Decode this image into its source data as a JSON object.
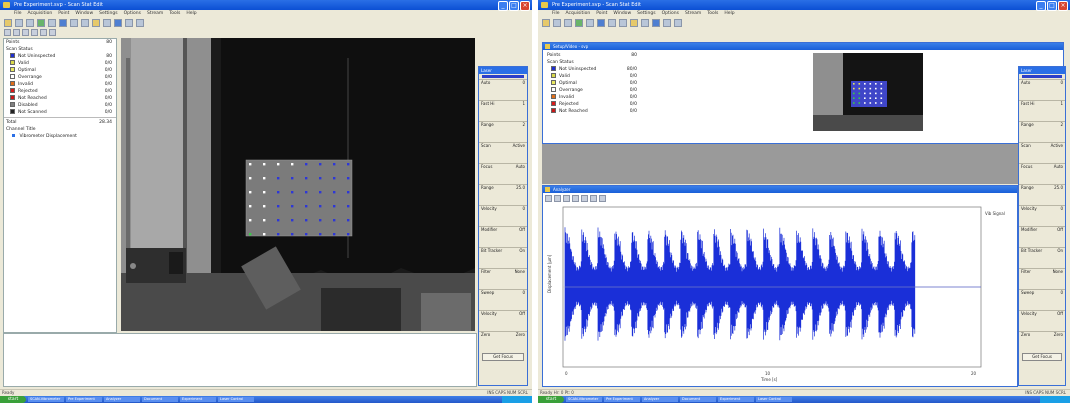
{
  "left": {
    "window_title": "Pre Experiment.svp - Scan Stat Edit",
    "menu": [
      "File",
      "Acquisition",
      "Point",
      "Window",
      "Settings",
      "Options",
      "Stream",
      "Tools",
      "Help"
    ],
    "tree_header": {
      "label": "Points",
      "value": "80"
    },
    "tree_group": "Scan Status",
    "points": [
      {
        "label": "Not Uninspected",
        "value": "80",
        "color": "#1f2fd0"
      },
      {
        "label": "Valid",
        "value": "0/0",
        "color": "#d8d84a"
      },
      {
        "label": "Optimal",
        "value": "0/0",
        "color": "#e8e860"
      },
      {
        "label": "Overrange",
        "value": "0/0",
        "color": "#ffffff"
      },
      {
        "label": "Invalid",
        "value": "0/0",
        "color": "#e06e1a"
      },
      {
        "label": "Rejected",
        "value": "0/0",
        "color": "#d81a1a"
      },
      {
        "label": "Not Reached",
        "value": "0/0",
        "color": "#c81818"
      },
      {
        "label": "Disabled",
        "value": "0/0",
        "color": "#808080"
      },
      {
        "label": "Not Scanned",
        "value": "0/0",
        "color": "#222222"
      }
    ],
    "total": {
      "label": "Total",
      "value": "28.34"
    },
    "channel_group": "Channel Title",
    "channel_item": "Vibrometer Displacement",
    "strip_title": "Laser",
    "status": "Ready",
    "status_right": "INS  CAPS  NUM  SCRL"
  },
  "right": {
    "window_title": "Pre Experiment.svp - Scan Stat Edit",
    "menu": [
      "File",
      "Acquisition",
      "Point",
      "Window",
      "Settings",
      "Options",
      "Stream",
      "Tools",
      "Help"
    ],
    "video_title": "Setup/Video - svp",
    "tree_header": {
      "label": "Points",
      "value": "80"
    },
    "tree_group": "Scan Status",
    "points": [
      {
        "label": "Not Uninspected",
        "value": "80/0",
        "color": "#1f2fd0"
      },
      {
        "label": "Valid",
        "value": "0/0",
        "color": "#d8d84a"
      },
      {
        "label": "Optimal",
        "value": "0/0",
        "color": "#e8e860"
      },
      {
        "label": "Overrange",
        "value": "0/0",
        "color": "#ffffff"
      },
      {
        "label": "Invalid",
        "value": "0/0",
        "color": "#e06e1a"
      },
      {
        "label": "Rejected",
        "value": "0/0",
        "color": "#d81a1a"
      },
      {
        "label": "Not Reached",
        "value": "0/0",
        "color": "#c81818"
      }
    ],
    "analyzer_title": "Analyzer",
    "plot_ylabel": "Displacement [µm]",
    "plot_xlabel": "Time [s]",
    "plot_xticks": [
      "0",
      "10",
      "20"
    ],
    "plot_legend": "Vib Signal",
    "status": "Ready  Hr: 0 Pt: 0",
    "status_right": "INS  CAPS  NUM  SCRL"
  },
  "strip": {
    "header": "Laser",
    "sections": [
      {
        "label": "Auto",
        "value": "0"
      },
      {
        "label": "Fast Hi",
        "value": "1"
      },
      {
        "label": "Range",
        "value": "2"
      },
      {
        "label": "Scan",
        "value": "Active"
      },
      {
        "label": "Focus",
        "value": "Auto"
      },
      {
        "label": "Range",
        "value": "25.0"
      },
      {
        "label": "Velocity",
        "value": "0"
      },
      {
        "label": "Modifier",
        "value": "Off"
      },
      {
        "label": "Bit Tracker",
        "value": "On"
      },
      {
        "label": "Filter",
        "value": "None"
      },
      {
        "label": "Sweep",
        "value": "0"
      },
      {
        "label": "Velocity",
        "value": "Off"
      },
      {
        "label": "Zero",
        "value": "Zero"
      }
    ],
    "button": "Get Focus"
  },
  "taskbar": {
    "start": "start",
    "items": [
      "SCAN-Vibrometer",
      "Pre Experiment",
      "Analyzer",
      "Document",
      "Experiment",
      "Laser Control"
    ]
  },
  "colors": {
    "xp_blue": "#2a6fe6",
    "signal": "#1a2fd8",
    "grid_point_blue": "#2d37d8",
    "grid_point_white": "#ffffff"
  }
}
